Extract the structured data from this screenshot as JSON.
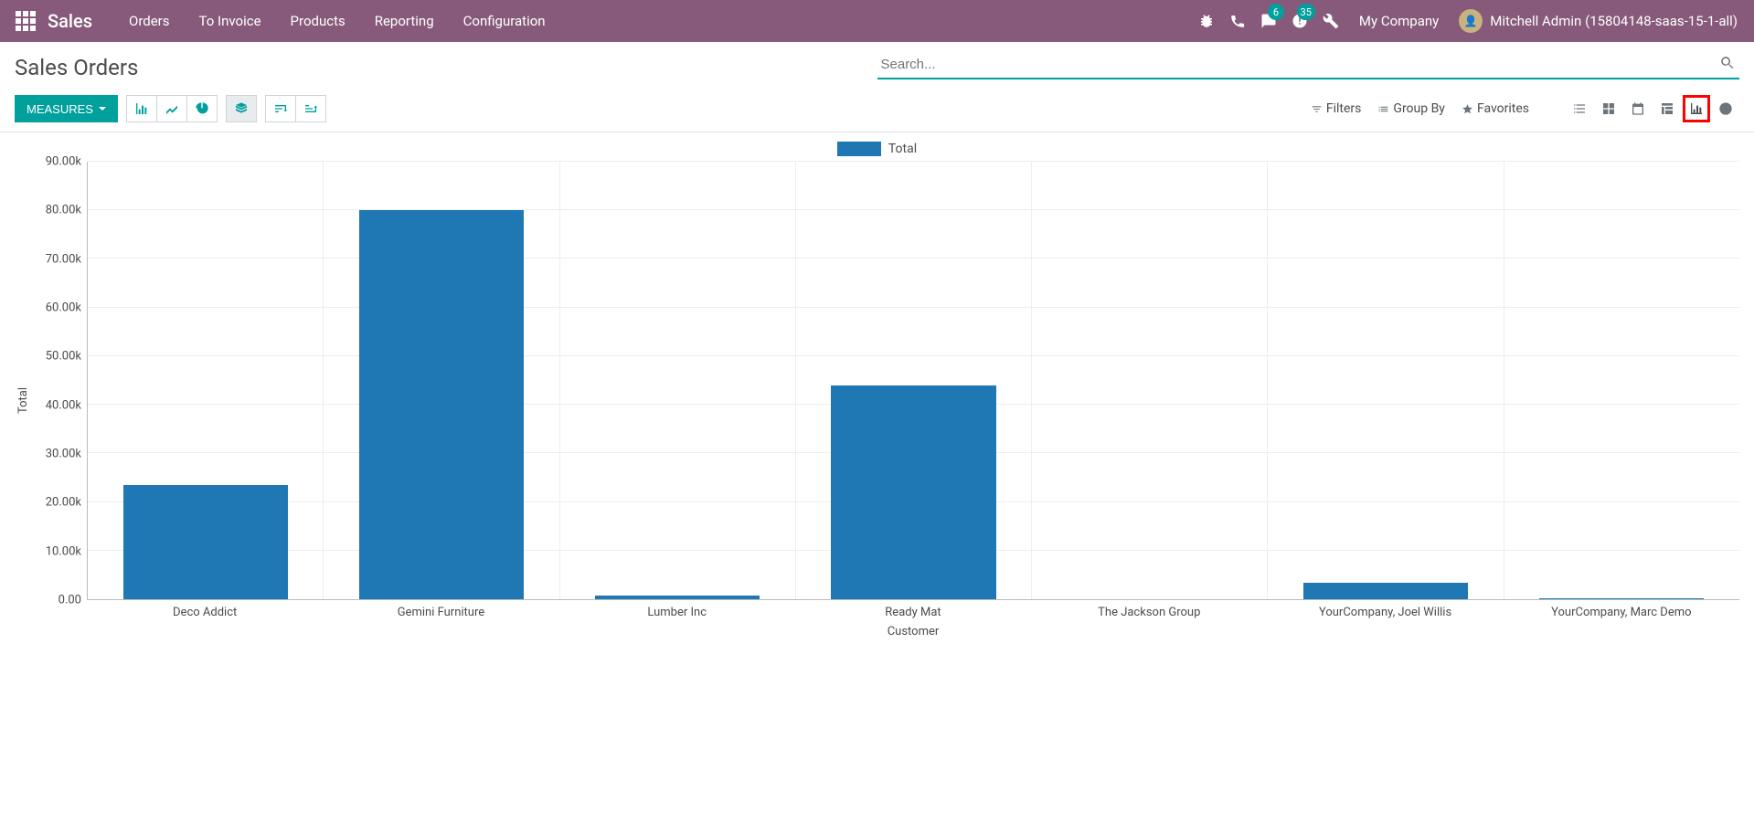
{
  "nav": {
    "app": "Sales",
    "menus": [
      "Orders",
      "To Invoice",
      "Products",
      "Reporting",
      "Configuration"
    ],
    "messages_badge": "6",
    "activities_badge": "35",
    "company": "My Company",
    "user": "Mitchell Admin (15804148-saas-15-1-all)"
  },
  "cp": {
    "title": "Sales Orders",
    "search_placeholder": "Search...",
    "measures_label": "MEASURES",
    "filters_label": "Filters",
    "groupby_label": "Group By",
    "favorites_label": "Favorites"
  },
  "chart_data": {
    "type": "bar",
    "title": "",
    "xlabel": "Customer",
    "ylabel": "Total",
    "legend": "Total",
    "categories": [
      "Deco Addict",
      "Gemini Furniture",
      "Lumber Inc",
      "Ready Mat",
      "The Jackson Group",
      "YourCompany, Joel Willis",
      "YourCompany, Marc Demo"
    ],
    "values": [
      23500,
      80000,
      800,
      44000,
      0,
      3300,
      200
    ],
    "ylim": [
      0,
      90000
    ],
    "yticks": [
      0,
      10000,
      20000,
      30000,
      40000,
      50000,
      60000,
      70000,
      80000,
      90000
    ],
    "ytick_labels": [
      "0.00",
      "10.00k",
      "20.00k",
      "30.00k",
      "40.00k",
      "50.00k",
      "60.00k",
      "70.00k",
      "80.00k",
      "90.00k"
    ]
  }
}
